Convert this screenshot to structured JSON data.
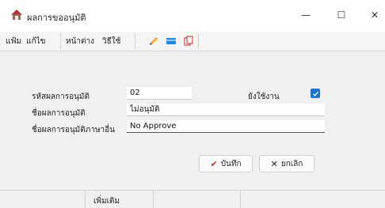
{
  "window": {
    "title": "ผลการขออนุมัติ",
    "controls": {
      "minimize": "—",
      "maximize": "☐",
      "close": "✕"
    }
  },
  "menu": {
    "items": [
      "แฟ้ม",
      "แก้ไข",
      "หน้าต่าง",
      "วิธีใช้"
    ]
  },
  "toolbar": {
    "icons": [
      "pencil-icon",
      "card-icon",
      "copy-icon"
    ]
  },
  "form": {
    "code_label": "รหัสผลการอนุมัติ",
    "code_value": "02",
    "active_label": "ยังใช้งาน",
    "active_checked": true,
    "name_label": "ชื่อผลการอนุมัติ",
    "name_value": "ไม่อนุมัติ",
    "alt_name_label": "ชื่อผลการอนุมัติภาษาอื่น",
    "alt_name_value": "No Approve"
  },
  "buttons": {
    "save": {
      "icon": "✔",
      "label": "บันทึก"
    },
    "cancel": {
      "icon": "✕",
      "label": "ยกเลิก"
    }
  },
  "footer": {
    "label": "เพิ่มเติม"
  },
  "colors": {
    "accent": "#1976d2",
    "save_check": "#d32f2f"
  }
}
